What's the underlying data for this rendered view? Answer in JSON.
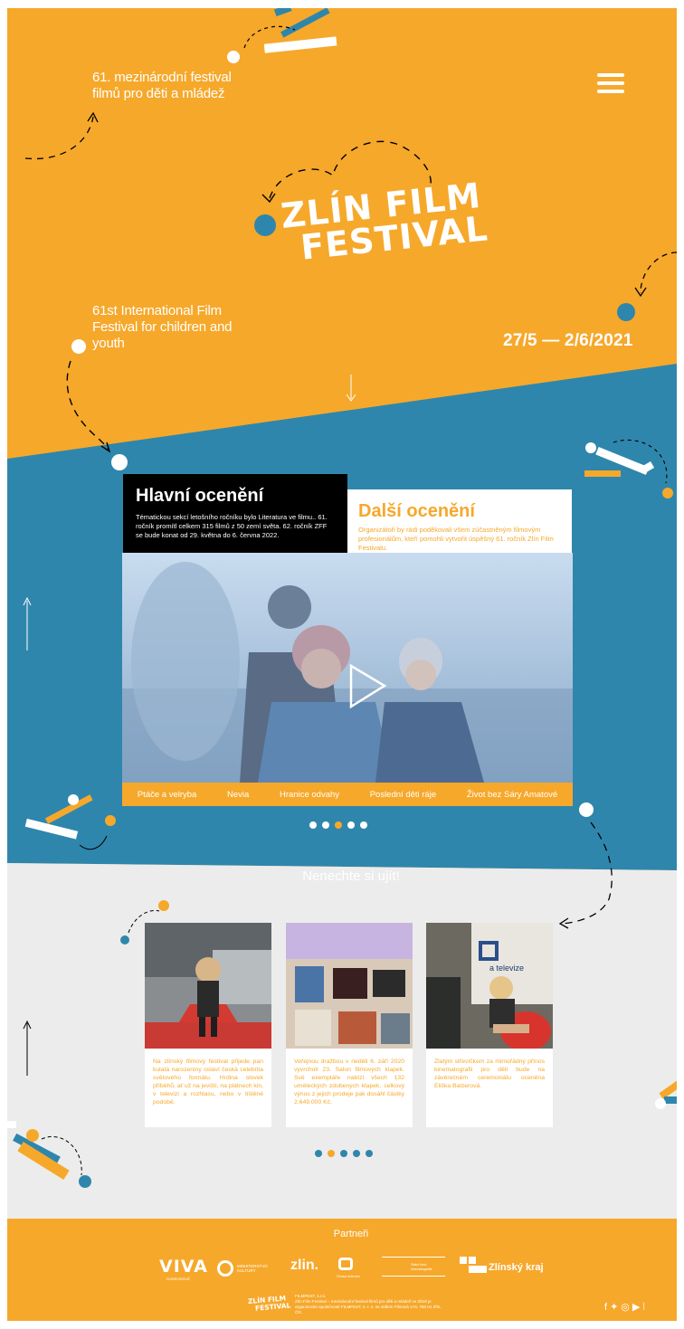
{
  "header": {
    "tagline_cz": "61. mezinárodní festival filmů pro děti a mládež",
    "tagline_en": "61st International Film Festival for children and youth",
    "logo_line1": "ZLÍN FILM",
    "logo_line2": "FESTIVAL",
    "dates": "27/5 — 2/6/2021",
    "menu_icon": "hamburger-icon"
  },
  "awards": {
    "main": {
      "title": "Hlavní ocenění",
      "text": "Tématickou sekcí letošního ročníku bylo Literatura ve filmu.. 61. ročník promítl celkem 315 filmů z 50 zemí světa. 62. ročník ZFF se bude konat od 29. května do 6. června 2022."
    },
    "other": {
      "title": "Další ocenění",
      "text": "Organizátoři by rádi poděkovali všem zúčastněným filmovým profesionálům, kteří pomohli vytvořit úspěšný 61. ročník Zlín Film Festivalu."
    },
    "play_icon": "play-icon",
    "tabs": [
      "Ptáče a velryba",
      "Nevia",
      "Hranice odvahy",
      "Poslední děti ráje",
      "Život bez Sáry Amatové"
    ],
    "active_slide": 3,
    "slide_count": 5
  },
  "news": {
    "title": "Nenechte si ujít!",
    "cards": [
      {
        "text": "Na zlínský filmový festival přijede pan kulatá narozeniny oslaví česká celebrita světového formátu. Hrdina slovek příběhů, ať už na jevišti, na plátnech kin, v televizi a rozhlasu, nebo v tištěné podobě."
      },
      {
        "text": "Veřejnou dražbou v neděli 6. září 2020 vyvrcholí 23. Salon filmových klapek. Své exempláře nabízí všech 132 uměleckých zdobených klapek, celkový výnos z jejich prodeje pak dosáhl částky 2.649.000 Kč."
      },
      {
        "text": "Zlatým střevíčkem za mimořádný přínos kinematografii pro děti bude na závěrečném ceremoniálu oceněna Eliška Balzerová."
      }
    ],
    "card_tv_text": "a televize",
    "slide_count": 5,
    "active_slide": 2
  },
  "partners": {
    "title": "Partneři",
    "items": [
      "VIVA",
      "MINISTERSTVO KULTURY",
      "zlin.",
      "Česká televize",
      "Státní fond kinematografie",
      "Zlínský kraj"
    ],
    "viva_sub": "DOBRODRUŽ"
  },
  "footer": {
    "logo_line1": "ZLÍN FILM",
    "logo_line2": "FESTIVAL",
    "company": "FILMFEST, s.r.o.",
    "line1": "Zlín Film Festival – mezinárodní festival filmů pro děti a mládež ve Zlíně je",
    "line2": "organizován společností FILMFEST, s. r. o. se sídlem Filmová 174, 760 01 Zlín, ČR.",
    "social_icons": [
      "facebook-icon",
      "twitter-icon",
      "instagram-icon",
      "youtube-icon",
      "rss-icon"
    ]
  },
  "colors": {
    "orange": "#f6a82b",
    "blue": "#2f86ac",
    "light_gray": "#ececec",
    "black": "#000000",
    "white": "#ffffff"
  }
}
